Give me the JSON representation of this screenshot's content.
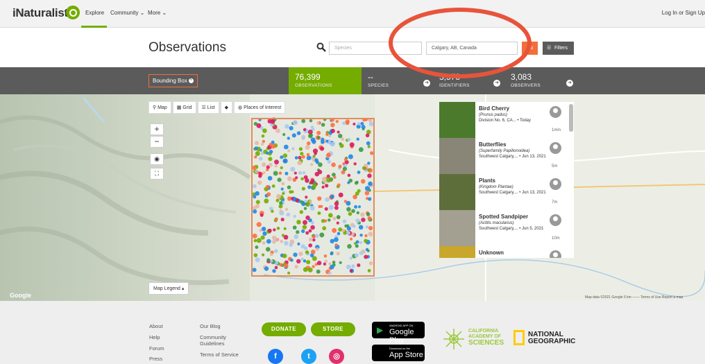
{
  "nav": {
    "logo": "iNaturalist",
    "explore": "Explore",
    "community": "Community ⌄",
    "more": "More ⌄",
    "login": "Log In or Sign Up"
  },
  "header": {
    "title": "Observations",
    "species_placeholder": "Species",
    "place_value": "Calgary, AB, Canada",
    "go": "Go",
    "filters": "Filters"
  },
  "statbar": {
    "bbox": "Bounding Box",
    "observations": {
      "num": "76,399",
      "label": "OBSERVATIONS"
    },
    "species": {
      "num": "--",
      "label": "SPECIES"
    },
    "identifiers": {
      "num": "3,578",
      "label": "IDENTIFIERS"
    },
    "observers": {
      "num": "3,083",
      "label": "OBSERVERS"
    }
  },
  "map_toolbar": {
    "map": "Map",
    "grid": "Grid",
    "list": "List",
    "layers": "",
    "places": "Places of Interest"
  },
  "map": {
    "zoom_in": "+",
    "zoom_out": "−",
    "legend": "Map Legend ▴",
    "google": "Google",
    "mapdata": "Map data ©2021 Google   5 km ───   Terms of Use   Report a map"
  },
  "observations": [
    {
      "name": "Bird Cherry",
      "sci": "(Prunus padus)",
      "loc": "Division No. 6, CA... • Today",
      "ago": "1min",
      "color": "#4c7a2c"
    },
    {
      "name": "Butterflies",
      "sci": "(Superfamily Papilionoidea)",
      "loc": "Southwest Calgary,... • Jun 13, 2021",
      "ago": "5m",
      "color": "#8a8677"
    },
    {
      "name": "Plants",
      "sci": "(Kingdom Plantae)",
      "loc": "Southwest Calgary,... • Jun 13, 2021",
      "ago": "7m",
      "color": "#5e6e3b"
    },
    {
      "name": "Spotted Sandpiper",
      "sci": "(Actitis macularius)",
      "loc": "Southwest Calgary,... • Jun 5, 2021",
      "ago": "10m",
      "color": "#a39f91"
    },
    {
      "name": "Unknown",
      "sci": "",
      "loc": "",
      "ago": "",
      "color": "#c8a72c"
    }
  ],
  "footer": {
    "about": "About",
    "help": "Help",
    "forum": "Forum",
    "press": "Press",
    "blog": "Our Blog",
    "community_guidelines_1": "Community",
    "community_guidelines_2": "Guidelines",
    "terms": "Terms of Service",
    "donate": "DONATE",
    "store": "STORE",
    "gp_small": "ANDROID APP ON",
    "gp_big": "Google Play",
    "as_small": "Download on the",
    "as_big": "App Store",
    "cas_1": "CALIFORNIA",
    "cas_2": "ACADEMY OF",
    "cas_3": "SCIENCES",
    "ng_1": "NATIONAL",
    "ng_2": "GEOGRAPHIC"
  },
  "colors": {
    "brand_green": "#74ac00",
    "accent_orange": "#f16f3a",
    "annotation_red": "#e8543a"
  }
}
